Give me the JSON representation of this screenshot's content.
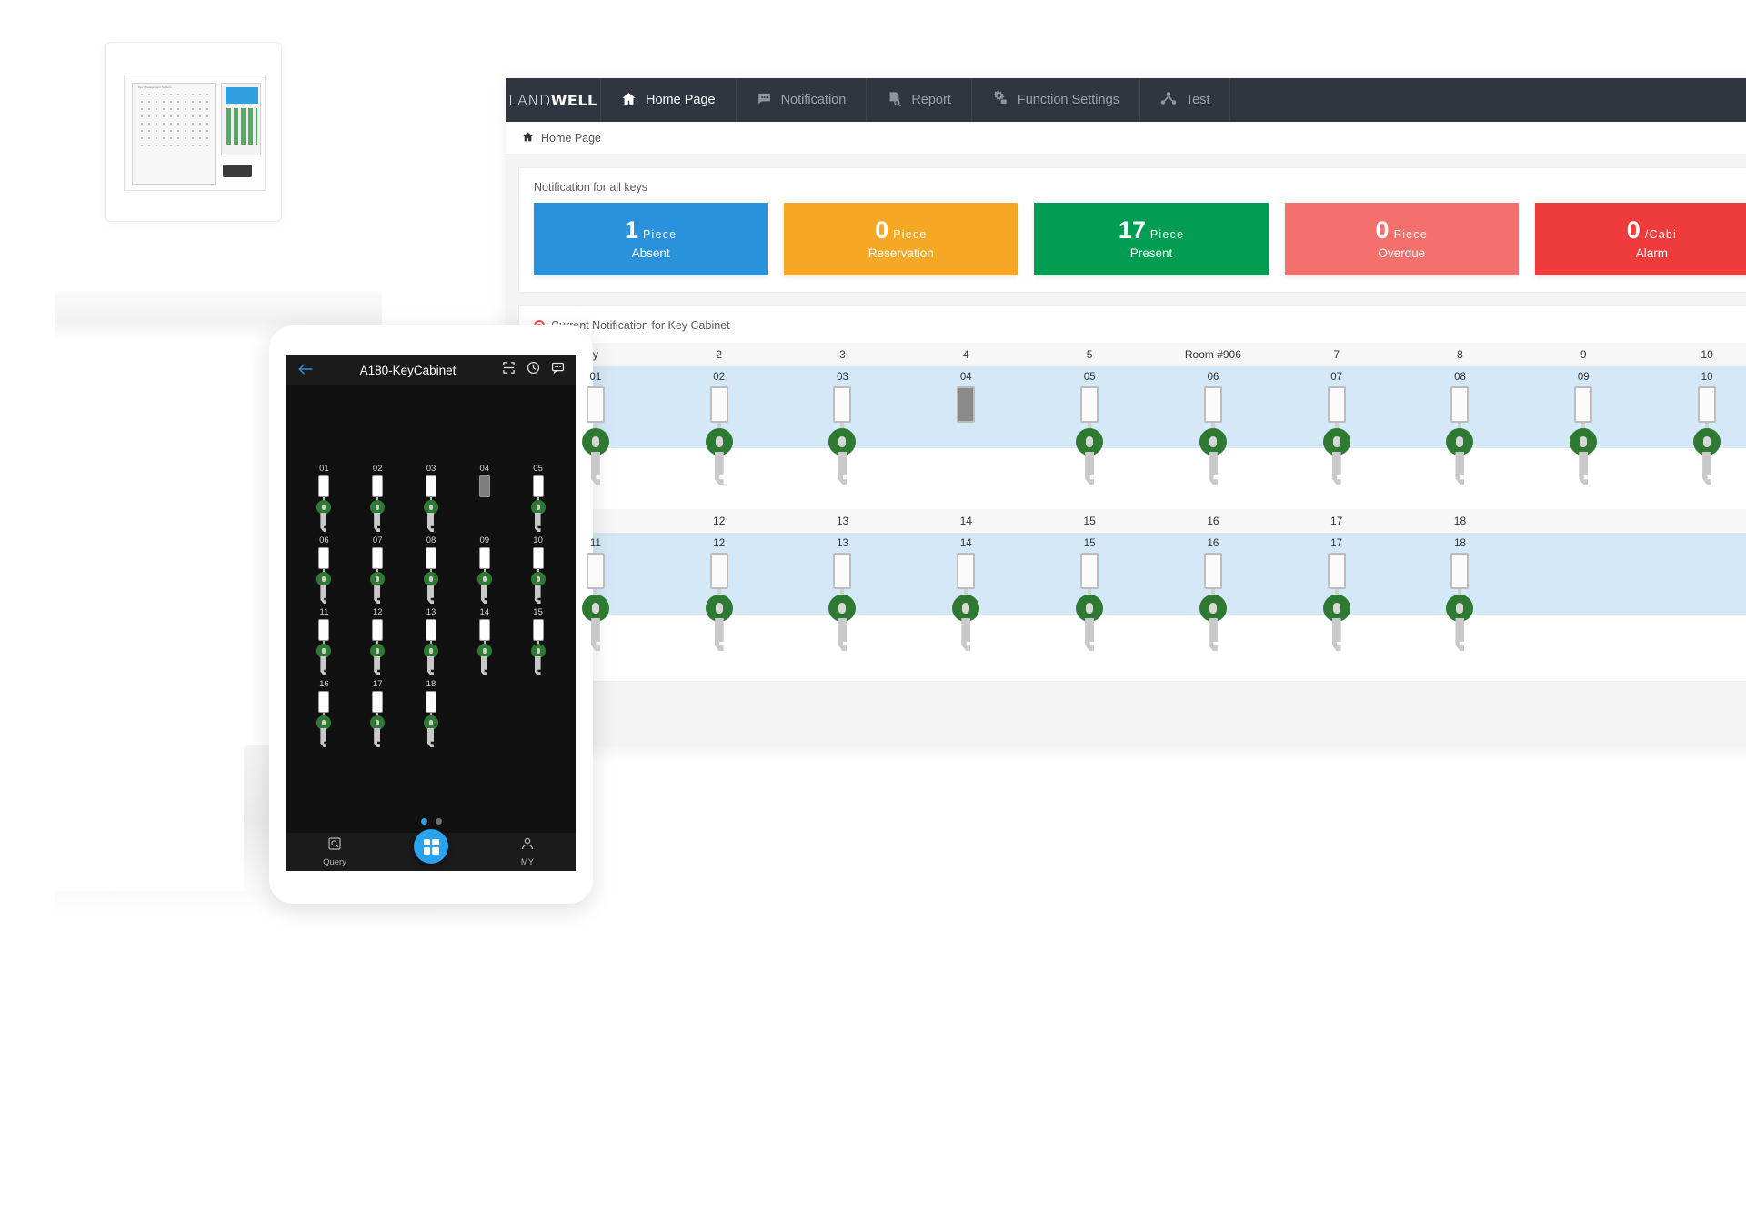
{
  "product_photo": {
    "device_label": "Key Management System"
  },
  "webapp": {
    "brand": {
      "light": "LAND",
      "bold": "WELL"
    },
    "nav": [
      {
        "label": "Home Page",
        "icon": "home-icon",
        "active": true
      },
      {
        "label": "Notification",
        "icon": "comment-icon",
        "active": false
      },
      {
        "label": "Report",
        "icon": "report-icon",
        "active": false
      },
      {
        "label": "Function Settings",
        "icon": "gear-icon",
        "active": false
      },
      {
        "label": "Test",
        "icon": "sitemap-icon",
        "active": false
      }
    ],
    "breadcrumb": {
      "icon": "home-icon",
      "label": "Home Page"
    },
    "notification_panel": {
      "title": "Notification for all keys",
      "cards": [
        {
          "value": "1",
          "unit": "Piece",
          "label": "Absent",
          "color": "#2a92dd"
        },
        {
          "value": "0",
          "unit": "Piece",
          "label": "Reservation",
          "color": "#f6a724"
        },
        {
          "value": "17",
          "unit": "Piece",
          "label": "Present",
          "color": "#009d52"
        },
        {
          "value": "0",
          "unit": "Piece",
          "label": "Overdue",
          "color": "#f4706d"
        },
        {
          "value": "0",
          "unit": "/Cabi",
          "label": "Alarm",
          "color": "#ef3b3b"
        }
      ]
    },
    "cabinet_panel": {
      "title": "Current Notification for Key Cabinet",
      "alert_icon": "alert-dot-icon",
      "row1": {
        "headers": [
          "y",
          "2",
          "3",
          "4",
          "5",
          "Room #906",
          "7",
          "8",
          "9",
          "10"
        ],
        "tags": [
          "01",
          "02",
          "03",
          "04",
          "05",
          "06",
          "07",
          "08",
          "09",
          "10"
        ],
        "status": [
          "present",
          "present",
          "present",
          "absent",
          "present",
          "present",
          "present",
          "present",
          "present",
          "present"
        ]
      },
      "row2": {
        "headers": [
          "",
          "12",
          "13",
          "14",
          "15",
          "16",
          "17",
          "18",
          "",
          ""
        ],
        "tags": [
          "11",
          "12",
          "13",
          "14",
          "15",
          "16",
          "17",
          "18",
          "",
          ""
        ],
        "status": [
          "present",
          "present",
          "present",
          "present",
          "present",
          "present",
          "present",
          "present",
          "",
          ""
        ]
      }
    }
  },
  "tablet_app": {
    "app_bar": {
      "back_icon": "back-arrow-icon",
      "title": "A180-KeyCabinet",
      "icons": [
        "scan-frame-icon",
        "clock-icon",
        "message-icon"
      ]
    },
    "keys": [
      {
        "no": "01",
        "status": "present"
      },
      {
        "no": "02",
        "status": "present"
      },
      {
        "no": "03",
        "status": "present"
      },
      {
        "no": "04",
        "status": "absent"
      },
      {
        "no": "05",
        "status": "present"
      },
      {
        "no": "06",
        "status": "present"
      },
      {
        "no": "07",
        "status": "present"
      },
      {
        "no": "08",
        "status": "present"
      },
      {
        "no": "09",
        "status": "present"
      },
      {
        "no": "10",
        "status": "present"
      },
      {
        "no": "11",
        "status": "present"
      },
      {
        "no": "12",
        "status": "present"
      },
      {
        "no": "13",
        "status": "present"
      },
      {
        "no": "14",
        "status": "present"
      },
      {
        "no": "15",
        "status": "present"
      },
      {
        "no": "16",
        "status": "present"
      },
      {
        "no": "17",
        "status": "present"
      },
      {
        "no": "18",
        "status": "present"
      }
    ],
    "pager": {
      "pages": 2,
      "active": 1
    },
    "tabbar": {
      "left": {
        "label": "Query",
        "icon": "search-box-icon"
      },
      "center": {
        "label": "",
        "icon": "grid-fab-icon"
      },
      "right": {
        "label": "MY",
        "icon": "person-icon"
      }
    }
  }
}
